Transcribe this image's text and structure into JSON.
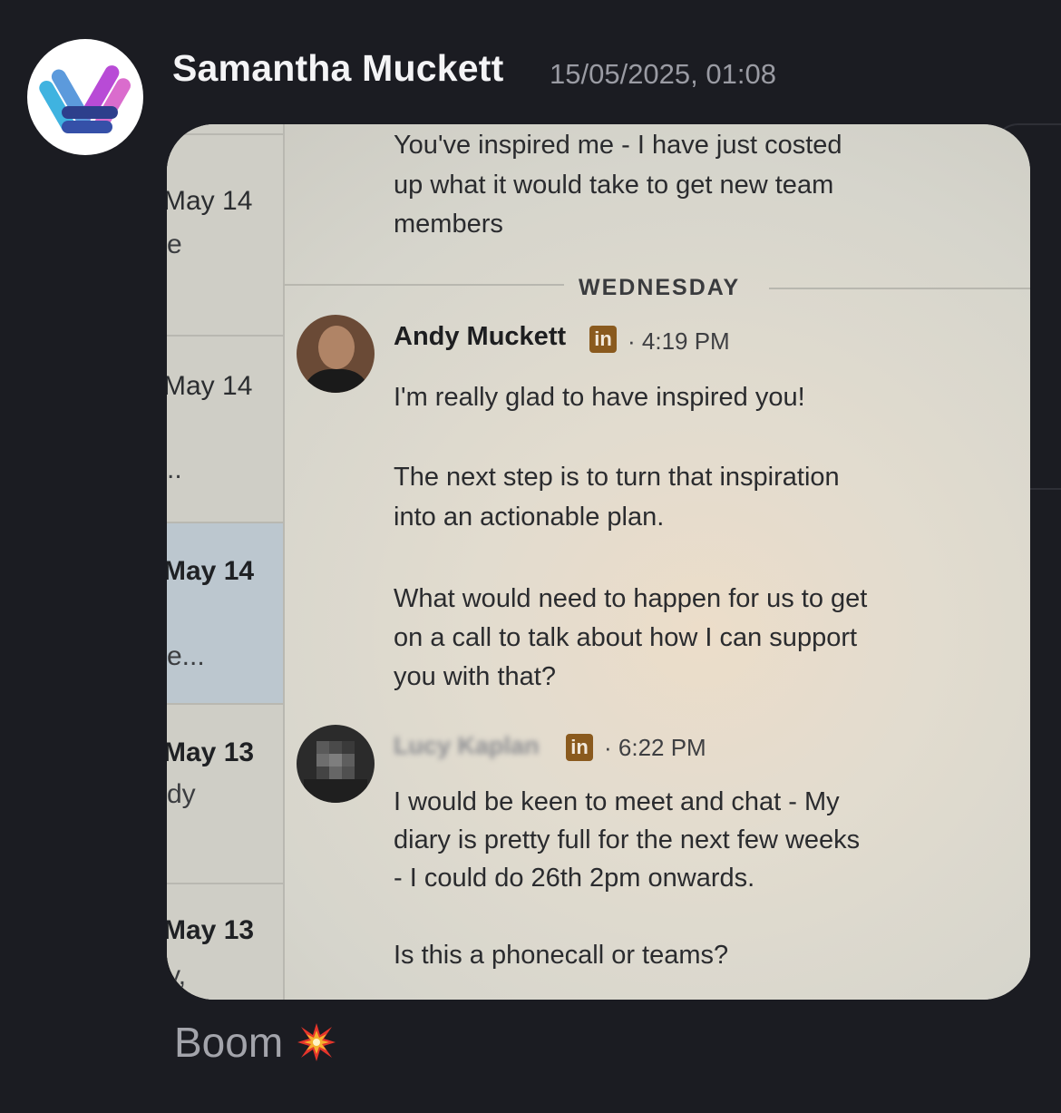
{
  "message": {
    "sender_name": "Samantha Muckett",
    "timestamp": "15/05/2025, 01:08",
    "caption": "Boom",
    "caption_emoji": "collision-icon"
  },
  "photo": {
    "sidebar": {
      "items": [
        {
          "date": "May 14",
          "snippet": "e"
        },
        {
          "date": "May 14",
          "snippet": ".."
        },
        {
          "date": "May 14",
          "snippet": "e..."
        },
        {
          "date": "May 13",
          "snippet": "dy"
        },
        {
          "date": "May 13",
          "snippet": "y,"
        }
      ]
    },
    "conversation": {
      "previous_message_lines": [
        "You've inspired me - I have just costed",
        "up what it would take to get new team",
        "members"
      ],
      "day_separator": "WEDNESDAY",
      "andy": {
        "name": "Andy Muckett",
        "time": "· 4:19 PM",
        "badge": "in",
        "lines": [
          "I'm really glad to have inspired you!",
          "",
          "The next step is to turn that inspiration",
          "into an actionable plan.",
          "",
          "What would need to happen for us to get",
          "on a call to talk about how I can support",
          "you with that?"
        ]
      },
      "reply": {
        "name_redacted": "Lucy Kaplan",
        "time": "· 6:22 PM",
        "badge": "in",
        "lines": [
          "I would be keen to meet and chat - My",
          "diary is pretty full for the next few weeks",
          "- I could do 26th 2pm onwards.",
          "",
          "Is this a phonecall or teams?"
        ]
      }
    }
  },
  "colors": {
    "background": "#1b1c22",
    "linkedin_badge": "#8a5a1e",
    "selected_conversation": "#bcc7cf"
  }
}
